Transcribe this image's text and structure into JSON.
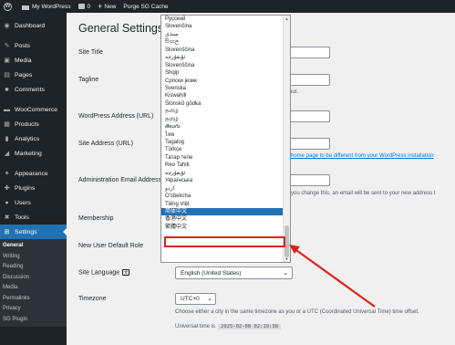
{
  "adminbar": {
    "site_name": "My WordPress",
    "comments_count": "0",
    "new_label": "New",
    "purge_label": "Purge SG Cache"
  },
  "sidebar": {
    "items": [
      {
        "label": "Dashboard",
        "icon": "dashboard-icon",
        "glyph": "◉"
      },
      {
        "label": "Posts",
        "icon": "pin-icon",
        "glyph": "✎"
      },
      {
        "label": "Media",
        "icon": "media-icon",
        "glyph": "▣"
      },
      {
        "label": "Pages",
        "icon": "page-icon",
        "glyph": "▤"
      },
      {
        "label": "Comments",
        "icon": "comment-icon",
        "glyph": "■"
      },
      {
        "label": "WooCommerce",
        "icon": "woocommerce-icon",
        "glyph": "▬"
      },
      {
        "label": "Products",
        "icon": "products-icon",
        "glyph": "▦"
      },
      {
        "label": "Analytics",
        "icon": "analytics-icon",
        "glyph": "▮"
      },
      {
        "label": "Marketing",
        "icon": "marketing-icon",
        "glyph": "◢"
      },
      {
        "label": "Appearance",
        "icon": "appearance-icon",
        "glyph": "✦"
      },
      {
        "label": "Plugins",
        "icon": "plugins-icon",
        "glyph": "✚"
      },
      {
        "label": "Users",
        "icon": "users-icon",
        "glyph": "●"
      },
      {
        "label": "Tools",
        "icon": "tools-icon",
        "glyph": "✖"
      },
      {
        "label": "Settings",
        "icon": "settings-icon",
        "glyph": "⊞"
      }
    ],
    "submenu": [
      "General",
      "Writing",
      "Reading",
      "Discussion",
      "Media",
      "Permalinks",
      "Privacy",
      "SG Plugin"
    ]
  },
  "main": {
    "title": "General Settings",
    "labels": {
      "site_title": "Site Title",
      "tagline": "Tagline",
      "wp_address": "WordPress Address (URL)",
      "site_address": "Site Address (URL)",
      "admin_email": "Administration Email Address",
      "membership": "Membership",
      "default_role": "New User Default Role",
      "site_language": "Site Language",
      "timezone": "Timezone"
    },
    "tagline_desc_tail": "out.",
    "site_address_desc": "home page to be different from your WordPress installation",
    "admin_email_desc": "you change this, an email will be sent to your new address t",
    "site_language_value": "English (United States)",
    "timezone_value": "UTC+0",
    "timezone_desc": "Choose either a city in the same timezone as you or a UTC (Coordinated Universal Time) time offset.",
    "universal_time_label": "Universal time is",
    "universal_time_value": "2025-02-08 02:19:38"
  },
  "dropdown": {
    "options": [
      "Русский",
      "Slovenčina",
      "سنڌي",
      "සිංහල",
      "Slovenščina",
      "ئۇيغۇرچە",
      "Slovenščina",
      "Shqip",
      "Српски језик",
      "Svenska",
      "Kiswahili",
      "Ślōnskŏ gŏdka",
      "தமிழ்",
      "தமிழ்",
      "తెలుగు",
      "ไทย",
      "Tagalog",
      "Türkçe",
      "Татар теле",
      "Reo Tahiti",
      "ئۇيغۇرچە",
      "Українська",
      "اردو",
      "O'zbekcha",
      "Tiếng Việt",
      "简体中文",
      "香港中文",
      "繁體中文"
    ],
    "selected_index": 25
  }
}
